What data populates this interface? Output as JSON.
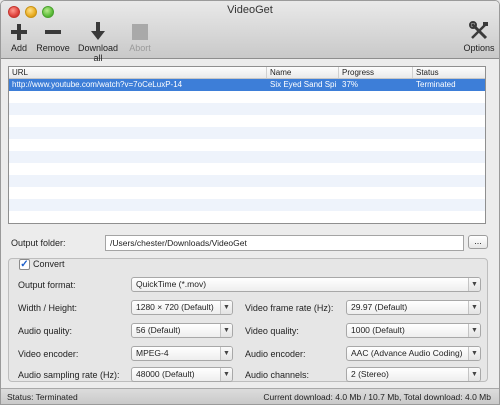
{
  "window": {
    "title": "VideoGet"
  },
  "toolbar": {
    "add": "Add",
    "remove": "Remove",
    "download_all": "Download all",
    "abort": "Abort",
    "options": "Options"
  },
  "table": {
    "headers": {
      "url": "URL",
      "name": "Name",
      "progress": "Progress",
      "status": "Status"
    },
    "rows": [
      {
        "url": "http://www.youtube.com/watch?v=7oCeLuxP-14",
        "name": "Six Eyed Sand Spi",
        "progress": "37%",
        "status": "Terminated"
      }
    ]
  },
  "output": {
    "label": "Output folder:",
    "path": "/Users/chester/Downloads/VideoGet",
    "browse": "..."
  },
  "convert": {
    "label": "Convert",
    "checked": true,
    "output_format": {
      "label": "Output format:",
      "value": "QuickTime (*.mov)"
    },
    "width_height": {
      "label": "Width / Height:",
      "value": "1280 × 720 (Default)"
    },
    "video_frame_rate": {
      "label": "Video frame rate (Hz):",
      "value": "29.97 (Default)"
    },
    "audio_quality": {
      "label": "Audio quality:",
      "value": "56 (Default)"
    },
    "video_quality": {
      "label": "Video quality:",
      "value": "1000 (Default)"
    },
    "video_encoder": {
      "label": "Video encoder:",
      "value": "MPEG-4"
    },
    "audio_encoder": {
      "label": "Audio encoder:",
      "value": "AAC (Advance Audio Coding)"
    },
    "audio_sampling_rate": {
      "label": "Audio sampling rate (Hz):",
      "value": "48000 (Default)"
    },
    "audio_channels": {
      "label": "Audio channels:",
      "value": "2 (Stereo)"
    }
  },
  "statusbar": {
    "status": "Status: Terminated",
    "download": "Current download: 4.0 Mb / 10.7 Mb, Total download: 4.0 Mb"
  },
  "icons": {
    "add": "plus-icon",
    "remove": "minus-icon",
    "download_all": "download-arrow-icon",
    "abort": "stop-icon",
    "options": "tools-icon"
  }
}
